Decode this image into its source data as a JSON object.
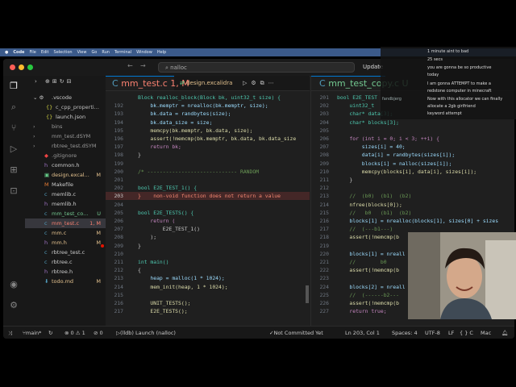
{
  "menubar": {
    "items": [
      "Code",
      "File",
      "Edit",
      "Selection",
      "View",
      "Go",
      "Run",
      "Terminal",
      "Window",
      "Help"
    ],
    "clock": "Sun Jan 28 8:19 PM"
  },
  "titlebar": {
    "command_center": "nalloc",
    "update_label": "Update"
  },
  "explorer": {
    "items": [
      {
        "label": ".vscode",
        "status": ""
      },
      {
        "label": "c_cpp_properti...",
        "status": ""
      },
      {
        "label": "launch.json",
        "status": ""
      },
      {
        "label": "bins",
        "status": ""
      },
      {
        "label": "mm_test.dSYM",
        "status": ""
      },
      {
        "label": "rbtree_test.dSYM",
        "status": ""
      },
      {
        "label": ".gitignore",
        "status": ""
      },
      {
        "label": "common.h",
        "status": ""
      },
      {
        "label": "design.excal...",
        "status": "M"
      },
      {
        "label": "Makefile",
        "status": ""
      },
      {
        "label": "memlib.c",
        "status": ""
      },
      {
        "label": "memlib.h",
        "status": ""
      },
      {
        "label": "mm_test_co...",
        "status": "U"
      },
      {
        "label": "mm_test.c",
        "status": "1, M"
      },
      {
        "label": "mm.c",
        "status": "M"
      },
      {
        "label": "mm.h",
        "status": "M"
      },
      {
        "label": "rbtree_test.c",
        "status": ""
      },
      {
        "label": "rbtree.c",
        "status": ""
      },
      {
        "label": "rbtree.h",
        "status": ""
      },
      {
        "label": "todo.md",
        "status": "M"
      }
    ]
  },
  "editor_left": {
    "tabs": [
      "mm_test.c 1, M",
      "design.excalidra"
    ],
    "lines": [
      {
        "n": "",
        "text": "Block realloc_block(Block bk, uint32_t size) {"
      },
      {
        "n": "192",
        "text": "    bk.memptr = nrealloc(bk.memptr, size);"
      },
      {
        "n": "193",
        "text": "    bk.data = randbytes(size);"
      },
      {
        "n": "194",
        "text": "    bk.data_size = size;"
      },
      {
        "n": "195",
        "text": "    memcpy(bk.memptr, bk.data, size);"
      },
      {
        "n": "196",
        "text": "    assert(!memcmp(bk.memptr, bk.data, bk.data_size"
      },
      {
        "n": "197",
        "text": "    return bk;"
      },
      {
        "n": "198",
        "text": "}"
      },
      {
        "n": "199",
        "text": ""
      },
      {
        "n": "200",
        "text": "/* ----------------------------- RANDOM"
      },
      {
        "n": "201",
        "text": ""
      },
      {
        "n": "202",
        "text": "bool E2E_TEST_1() {"
      },
      {
        "n": "203",
        "text": "}    non-void function does not return a value"
      },
      {
        "n": "204",
        "text": ""
      },
      {
        "n": "205",
        "text": "bool E2E_TESTS() {"
      },
      {
        "n": "206",
        "text": "    return ("
      },
      {
        "n": "207",
        "text": "        E2E_TEST_1()"
      },
      {
        "n": "208",
        "text": "    );"
      },
      {
        "n": "209",
        "text": "}"
      },
      {
        "n": "210",
        "text": ""
      },
      {
        "n": "211",
        "text": "int main()"
      },
      {
        "n": "212",
        "text": "{"
      },
      {
        "n": "213",
        "text": "    heap = malloc(1 * 1024);"
      },
      {
        "n": "214",
        "text": "    mem_init(heap, 1 * 1024);"
      },
      {
        "n": "215",
        "text": ""
      },
      {
        "n": "216",
        "text": "    UNIT_TESTS();"
      },
      {
        "n": "217",
        "text": "    E2E_TESTS();"
      }
    ]
  },
  "editor_right": {
    "tabs": [
      "mm_test_copy.c U"
    ],
    "lines": [
      {
        "n": "201",
        "text": "bool E2E_TEST"
      },
      {
        "n": "202",
        "text": "    uint32_t"
      },
      {
        "n": "203",
        "text": "    char* data[3];"
      },
      {
        "n": "204",
        "text": "    char* blocks[3];"
      },
      {
        "n": "205",
        "text": ""
      },
      {
        "n": "206",
        "text": "    for (int i = 0; i < 3; ++i) {"
      },
      {
        "n": "207",
        "text": "        sizes[i] = 40;"
      },
      {
        "n": "208",
        "text": "        data[i] = randbytes(sizes[i]);"
      },
      {
        "n": "209",
        "text": "        blocks[i] = nalloc(sizes[i]);"
      },
      {
        "n": "210",
        "text": "        memcpy(blocks[i], data[i], sizes[i]);"
      },
      {
        "n": "211",
        "text": "    }"
      },
      {
        "n": "212",
        "text": ""
      },
      {
        "n": "213",
        "text": "    //  (b0)  (b1)  (b2)"
      },
      {
        "n": "214",
        "text": "    nfree(blocks[0]);"
      },
      {
        "n": "215",
        "text": "    //   b0   (b1)  (b2)"
      },
      {
        "n": "216",
        "text": "    blocks[1] = nrealloc(blocks[1], sizes[0] + sizes"
      },
      {
        "n": "217",
        "text": "    //  (---b1---)"
      },
      {
        "n": "218",
        "text": "    assert(!memcmp(b"
      },
      {
        "n": "219",
        "text": ""
      },
      {
        "n": "220",
        "text": "    blocks[1] = nreall"
      },
      {
        "n": "221",
        "text": "    //        b0"
      },
      {
        "n": "222",
        "text": "    assert(!memcmp(b"
      },
      {
        "n": "223",
        "text": ""
      },
      {
        "n": "224",
        "text": "    blocks[2] = nreall"
      },
      {
        "n": "225",
        "text": "    //  (------b2---"
      },
      {
        "n": "226",
        "text": "    assert(!memcmp(b"
      },
      {
        "n": "227",
        "text": "    return true;"
      }
    ]
  },
  "statusbar": {
    "branch": "main*",
    "problems": "⊗ 0 ⚠ 1",
    "debug": "(lldb) Launch (nalloc)",
    "git": "Not Committed Yet",
    "cursor": "Ln 203, Col 1",
    "spaces": "Spaces: 4",
    "encoding": "UTF-8",
    "eol": "LF",
    "lang": "{ } C",
    "platform": "Mac"
  },
  "chat": [
    {
      "user": "",
      "text": "1 minute aint to bad"
    },
    {
      "user": "",
      "text": "25 secs"
    },
    {
      "user": "",
      "text": "you are gonna be so productive"
    },
    {
      "user": "",
      "text": "today"
    },
    {
      "user": "",
      "text": "I am gonna ATTEMPT to make a"
    },
    {
      "user": "",
      "text": "redstone computer in minecraft"
    },
    {
      "user": "fandbjerg",
      "text": "Now with this allocator we can finally"
    },
    {
      "user": "",
      "text": "allocate a 2gb girlfriend"
    },
    {
      "user": "",
      "text": "keyword attempt"
    }
  ],
  "colors": {
    "accent": "#0078d4",
    "error": "#f14c4c",
    "modified": "#e2c08d",
    "untracked": "#73c991"
  }
}
